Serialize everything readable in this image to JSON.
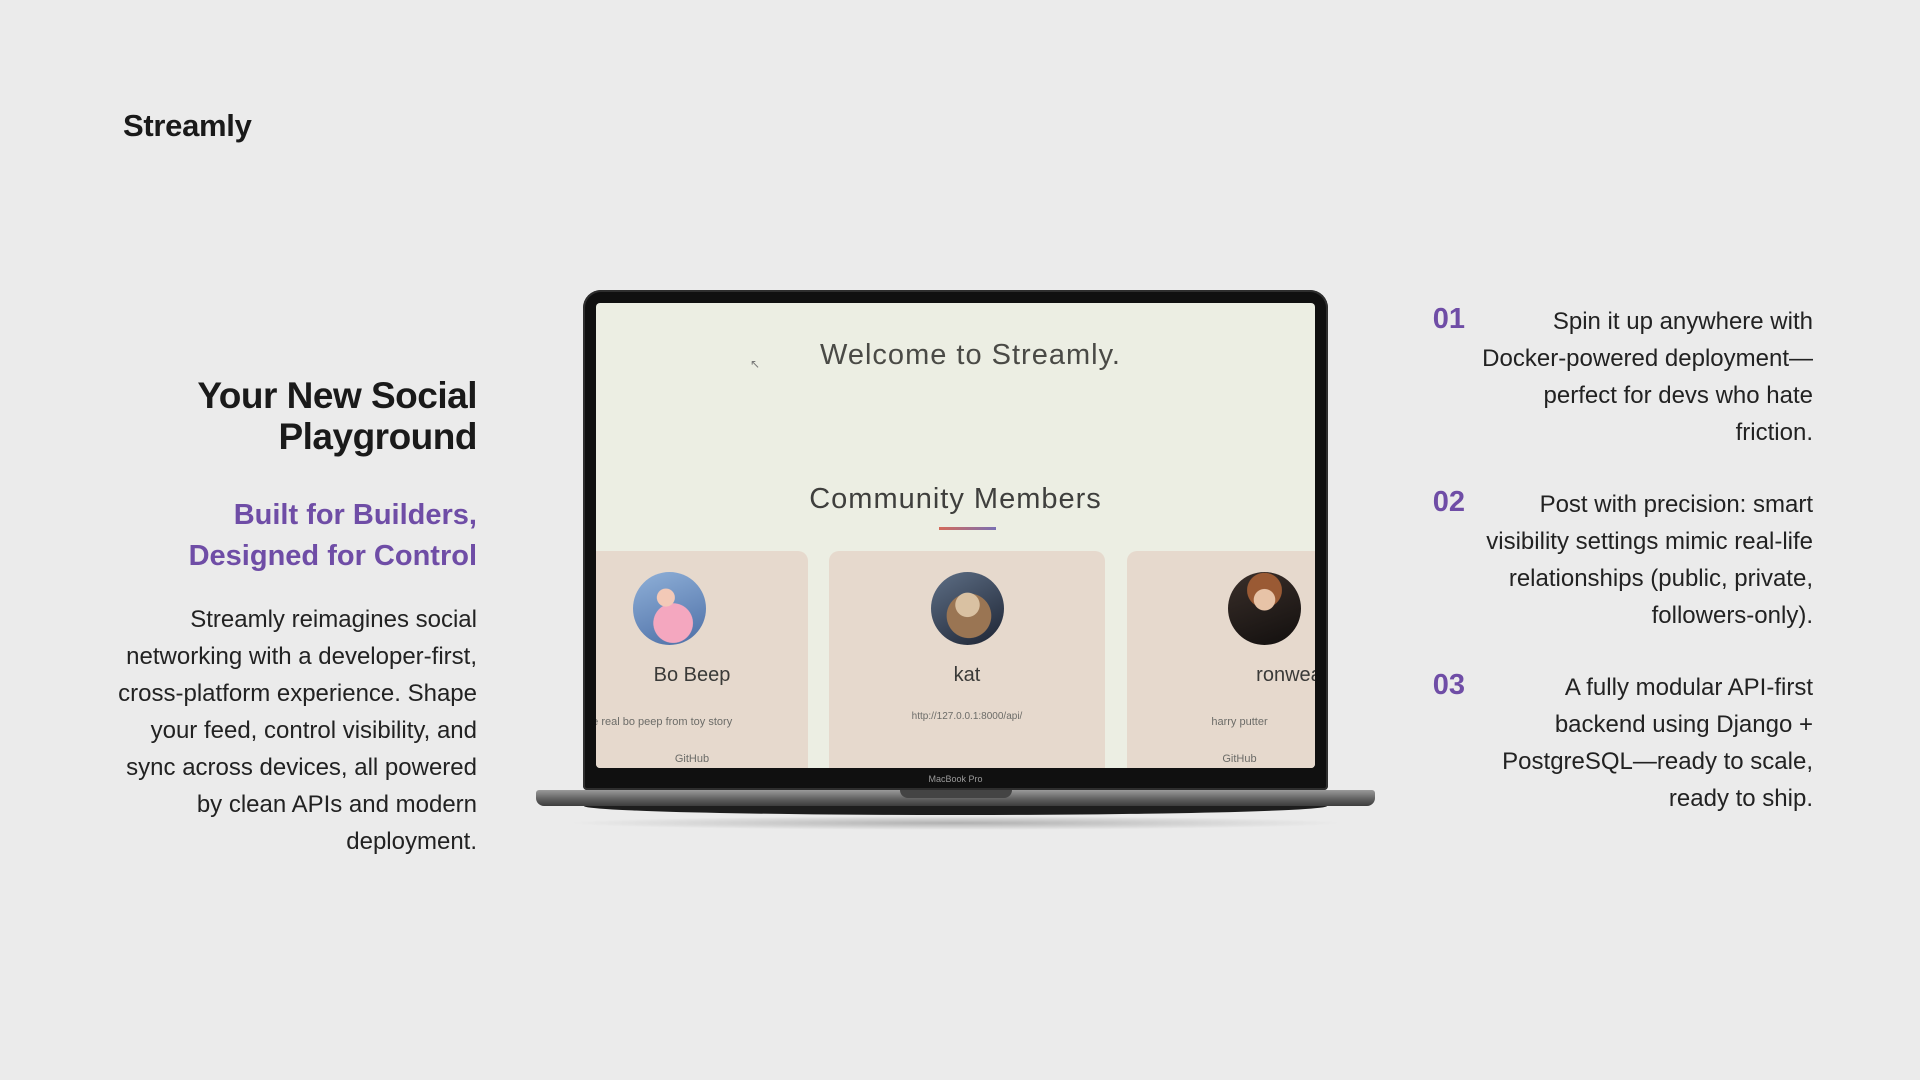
{
  "brand": "Streamly",
  "hero": {
    "headline": "Your New Social Playground",
    "subheadline": "Built for Builders, Designed for Control",
    "body": "Streamly reimagines social networking with a developer-first, cross-platform experience. Shape your feed, control visibility, and sync across devices, all powered by clean APIs and modern deployment."
  },
  "laptop": {
    "model_label": "MacBook Pro",
    "screen": {
      "welcome": "Welcome to Streamly.",
      "section_title": "Community Members",
      "members": [
        {
          "name": "Bo Beep",
          "bio": "the real bo peep from toy story",
          "link": "GitHub"
        },
        {
          "name": "kat",
          "bio": "http://127.0.0.1:8000/api/",
          "link": ""
        },
        {
          "name": "ronwealer",
          "bio": "harry putter",
          "link": "GitHub"
        }
      ]
    }
  },
  "features": [
    {
      "num": "01",
      "text": "Spin it up anywhere with Docker-powered deployment—perfect for devs who hate friction."
    },
    {
      "num": "02",
      "text": "Post with precision: smart visibility settings mimic real-life relationships (public, private, followers-only)."
    },
    {
      "num": "03",
      "text": "A fully modular API-first backend using Django + PostgreSQL—ready to scale, ready to ship."
    }
  ],
  "colors": {
    "accent": "#6f4da6",
    "background": "#ebebeb",
    "card": "#e6d9cd",
    "screen": "#eceee3"
  }
}
